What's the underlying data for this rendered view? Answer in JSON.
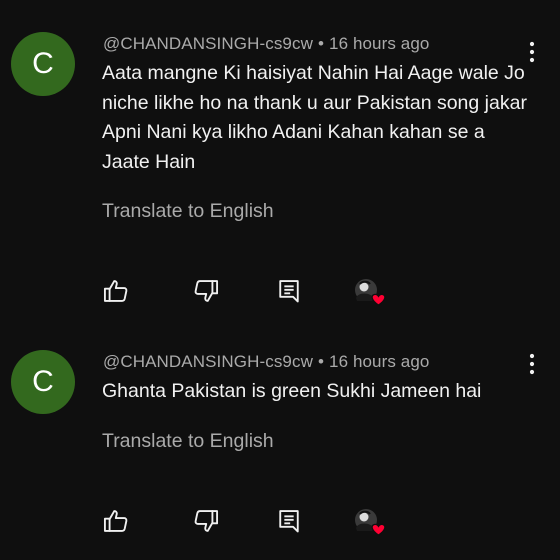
{
  "comments": [
    {
      "avatar_letter": "C",
      "author": "@CHANDANSINGH-cs9cw",
      "separator": "•",
      "time": "16 hours ago",
      "text": "Aata mangne Ki haisiyat Nahin Hai Aage wale Jo niche likhe ho na thank u aur Pakistan song jakar Apni Nani kya likho Adani Kahan kahan se a Jaate Hain",
      "translate_label": "Translate to English",
      "hearted": true
    },
    {
      "avatar_letter": "C",
      "author": "@CHANDANSINGH-cs9cw",
      "separator": "•",
      "time": "16 hours ago",
      "text": "Ghanta Pakistan is green Sukhi Jameen hai",
      "translate_label": "Translate to English",
      "hearted": true
    }
  ],
  "icons": {
    "more": "more-vert-icon",
    "like": "thumbs-up-icon",
    "dislike": "thumbs-down-icon",
    "reply": "comment-reply-icon",
    "hearted": "creator-heart-icon"
  },
  "colors": {
    "background": "#0f0f0f",
    "text_primary": "#f1f1f1",
    "text_secondary": "#aaaaaa",
    "avatar": "#33691e",
    "heart": "#ff0033"
  }
}
